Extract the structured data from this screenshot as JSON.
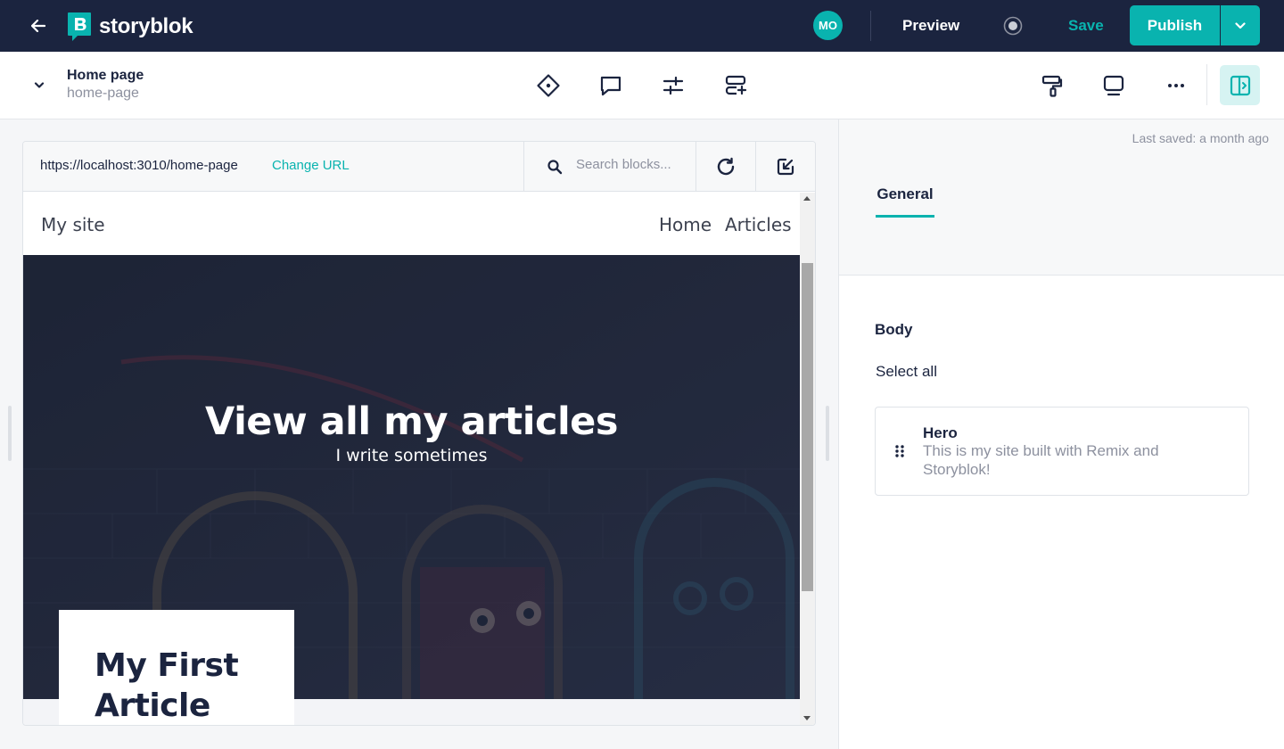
{
  "topbar": {
    "logo_text": "storyblok",
    "avatar_initials": "MO",
    "preview_label": "Preview",
    "save_label": "Save",
    "publish_label": "Publish"
  },
  "toolbar": {
    "story_title": "Home page",
    "story_slug": "home-page"
  },
  "preview": {
    "url": "https://localhost:3010/home-page",
    "change_url_label": "Change URL",
    "search_placeholder": "Search blocks...",
    "site": {
      "name": "My site",
      "nav": [
        "Home",
        "Articles"
      ],
      "hero_title": "View all my articles",
      "hero_subtitle": "I write sometimes",
      "article_title": "My First Article"
    }
  },
  "panel": {
    "last_saved": "Last saved: a month ago",
    "tab_general": "General",
    "body_label": "Body",
    "select_all": "Select all",
    "block": {
      "name": "Hero",
      "description": "This is my site built with Remix and Storyblok!"
    }
  },
  "colors": {
    "brand_dark": "#1b243f",
    "accent": "#09b3af"
  }
}
